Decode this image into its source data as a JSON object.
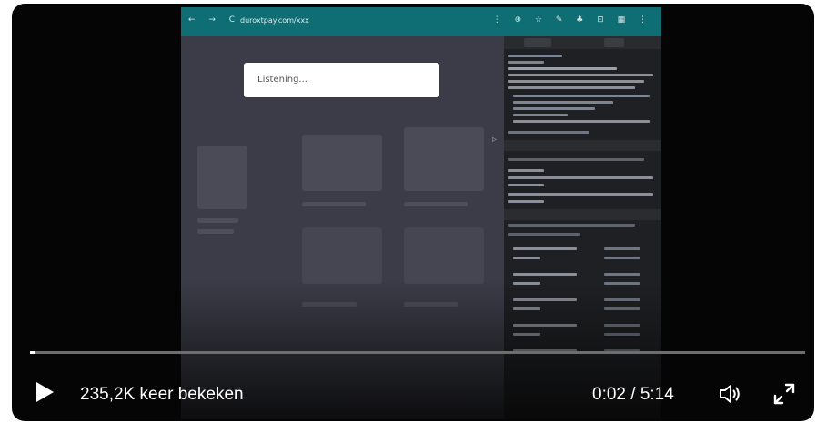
{
  "video_frame": {
    "browser": {
      "url": "duroxtpay.com/xxx",
      "nav_glyphs": "← → C",
      "toolbar_glyphs": "⋮ ⊕ ☆ ✎ ♣ ⊡ ▦ ⋮"
    },
    "popup_text": "Listening..."
  },
  "controls": {
    "play_icon": "play-icon",
    "views_text": "235,2K keer bekeken",
    "time_text": "0:02 / 5:14",
    "volume_icon": "volume-icon",
    "fullscreen_icon": "fullscreen-icon",
    "progress_fraction": 0.0064
  },
  "colors": {
    "player_bg": "#050505",
    "browser_bar": "#0f6e73",
    "devtools_bg": "#1f2023",
    "progress_track": "#6e6e6e",
    "progress_fill": "#ffffff"
  }
}
